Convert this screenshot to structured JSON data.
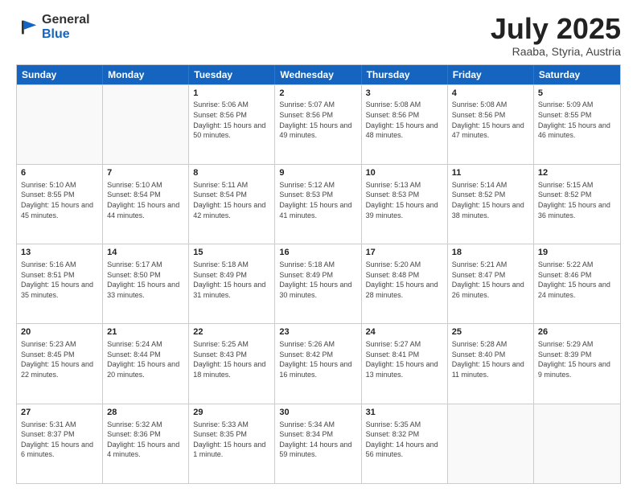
{
  "header": {
    "logo_general": "General",
    "logo_blue": "Blue",
    "month_title": "July 2025",
    "location": "Raaba, Styria, Austria"
  },
  "days_of_week": [
    "Sunday",
    "Monday",
    "Tuesday",
    "Wednesday",
    "Thursday",
    "Friday",
    "Saturday"
  ],
  "weeks": [
    [
      {
        "day": "",
        "sunrise": "",
        "sunset": "",
        "daylight": ""
      },
      {
        "day": "",
        "sunrise": "",
        "sunset": "",
        "daylight": ""
      },
      {
        "day": "1",
        "sunrise": "Sunrise: 5:06 AM",
        "sunset": "Sunset: 8:56 PM",
        "daylight": "Daylight: 15 hours and 50 minutes."
      },
      {
        "day": "2",
        "sunrise": "Sunrise: 5:07 AM",
        "sunset": "Sunset: 8:56 PM",
        "daylight": "Daylight: 15 hours and 49 minutes."
      },
      {
        "day": "3",
        "sunrise": "Sunrise: 5:08 AM",
        "sunset": "Sunset: 8:56 PM",
        "daylight": "Daylight: 15 hours and 48 minutes."
      },
      {
        "day": "4",
        "sunrise": "Sunrise: 5:08 AM",
        "sunset": "Sunset: 8:56 PM",
        "daylight": "Daylight: 15 hours and 47 minutes."
      },
      {
        "day": "5",
        "sunrise": "Sunrise: 5:09 AM",
        "sunset": "Sunset: 8:55 PM",
        "daylight": "Daylight: 15 hours and 46 minutes."
      }
    ],
    [
      {
        "day": "6",
        "sunrise": "Sunrise: 5:10 AM",
        "sunset": "Sunset: 8:55 PM",
        "daylight": "Daylight: 15 hours and 45 minutes."
      },
      {
        "day": "7",
        "sunrise": "Sunrise: 5:10 AM",
        "sunset": "Sunset: 8:54 PM",
        "daylight": "Daylight: 15 hours and 44 minutes."
      },
      {
        "day": "8",
        "sunrise": "Sunrise: 5:11 AM",
        "sunset": "Sunset: 8:54 PM",
        "daylight": "Daylight: 15 hours and 42 minutes."
      },
      {
        "day": "9",
        "sunrise": "Sunrise: 5:12 AM",
        "sunset": "Sunset: 8:53 PM",
        "daylight": "Daylight: 15 hours and 41 minutes."
      },
      {
        "day": "10",
        "sunrise": "Sunrise: 5:13 AM",
        "sunset": "Sunset: 8:53 PM",
        "daylight": "Daylight: 15 hours and 39 minutes."
      },
      {
        "day": "11",
        "sunrise": "Sunrise: 5:14 AM",
        "sunset": "Sunset: 8:52 PM",
        "daylight": "Daylight: 15 hours and 38 minutes."
      },
      {
        "day": "12",
        "sunrise": "Sunrise: 5:15 AM",
        "sunset": "Sunset: 8:52 PM",
        "daylight": "Daylight: 15 hours and 36 minutes."
      }
    ],
    [
      {
        "day": "13",
        "sunrise": "Sunrise: 5:16 AM",
        "sunset": "Sunset: 8:51 PM",
        "daylight": "Daylight: 15 hours and 35 minutes."
      },
      {
        "day": "14",
        "sunrise": "Sunrise: 5:17 AM",
        "sunset": "Sunset: 8:50 PM",
        "daylight": "Daylight: 15 hours and 33 minutes."
      },
      {
        "day": "15",
        "sunrise": "Sunrise: 5:18 AM",
        "sunset": "Sunset: 8:49 PM",
        "daylight": "Daylight: 15 hours and 31 minutes."
      },
      {
        "day": "16",
        "sunrise": "Sunrise: 5:18 AM",
        "sunset": "Sunset: 8:49 PM",
        "daylight": "Daylight: 15 hours and 30 minutes."
      },
      {
        "day": "17",
        "sunrise": "Sunrise: 5:20 AM",
        "sunset": "Sunset: 8:48 PM",
        "daylight": "Daylight: 15 hours and 28 minutes."
      },
      {
        "day": "18",
        "sunrise": "Sunrise: 5:21 AM",
        "sunset": "Sunset: 8:47 PM",
        "daylight": "Daylight: 15 hours and 26 minutes."
      },
      {
        "day": "19",
        "sunrise": "Sunrise: 5:22 AM",
        "sunset": "Sunset: 8:46 PM",
        "daylight": "Daylight: 15 hours and 24 minutes."
      }
    ],
    [
      {
        "day": "20",
        "sunrise": "Sunrise: 5:23 AM",
        "sunset": "Sunset: 8:45 PM",
        "daylight": "Daylight: 15 hours and 22 minutes."
      },
      {
        "day": "21",
        "sunrise": "Sunrise: 5:24 AM",
        "sunset": "Sunset: 8:44 PM",
        "daylight": "Daylight: 15 hours and 20 minutes."
      },
      {
        "day": "22",
        "sunrise": "Sunrise: 5:25 AM",
        "sunset": "Sunset: 8:43 PM",
        "daylight": "Daylight: 15 hours and 18 minutes."
      },
      {
        "day": "23",
        "sunrise": "Sunrise: 5:26 AM",
        "sunset": "Sunset: 8:42 PM",
        "daylight": "Daylight: 15 hours and 16 minutes."
      },
      {
        "day": "24",
        "sunrise": "Sunrise: 5:27 AM",
        "sunset": "Sunset: 8:41 PM",
        "daylight": "Daylight: 15 hours and 13 minutes."
      },
      {
        "day": "25",
        "sunrise": "Sunrise: 5:28 AM",
        "sunset": "Sunset: 8:40 PM",
        "daylight": "Daylight: 15 hours and 11 minutes."
      },
      {
        "day": "26",
        "sunrise": "Sunrise: 5:29 AM",
        "sunset": "Sunset: 8:39 PM",
        "daylight": "Daylight: 15 hours and 9 minutes."
      }
    ],
    [
      {
        "day": "27",
        "sunrise": "Sunrise: 5:31 AM",
        "sunset": "Sunset: 8:37 PM",
        "daylight": "Daylight: 15 hours and 6 minutes."
      },
      {
        "day": "28",
        "sunrise": "Sunrise: 5:32 AM",
        "sunset": "Sunset: 8:36 PM",
        "daylight": "Daylight: 15 hours and 4 minutes."
      },
      {
        "day": "29",
        "sunrise": "Sunrise: 5:33 AM",
        "sunset": "Sunset: 8:35 PM",
        "daylight": "Daylight: 15 hours and 1 minute."
      },
      {
        "day": "30",
        "sunrise": "Sunrise: 5:34 AM",
        "sunset": "Sunset: 8:34 PM",
        "daylight": "Daylight: 14 hours and 59 minutes."
      },
      {
        "day": "31",
        "sunrise": "Sunrise: 5:35 AM",
        "sunset": "Sunset: 8:32 PM",
        "daylight": "Daylight: 14 hours and 56 minutes."
      },
      {
        "day": "",
        "sunrise": "",
        "sunset": "",
        "daylight": ""
      },
      {
        "day": "",
        "sunrise": "",
        "sunset": "",
        "daylight": ""
      }
    ]
  ]
}
